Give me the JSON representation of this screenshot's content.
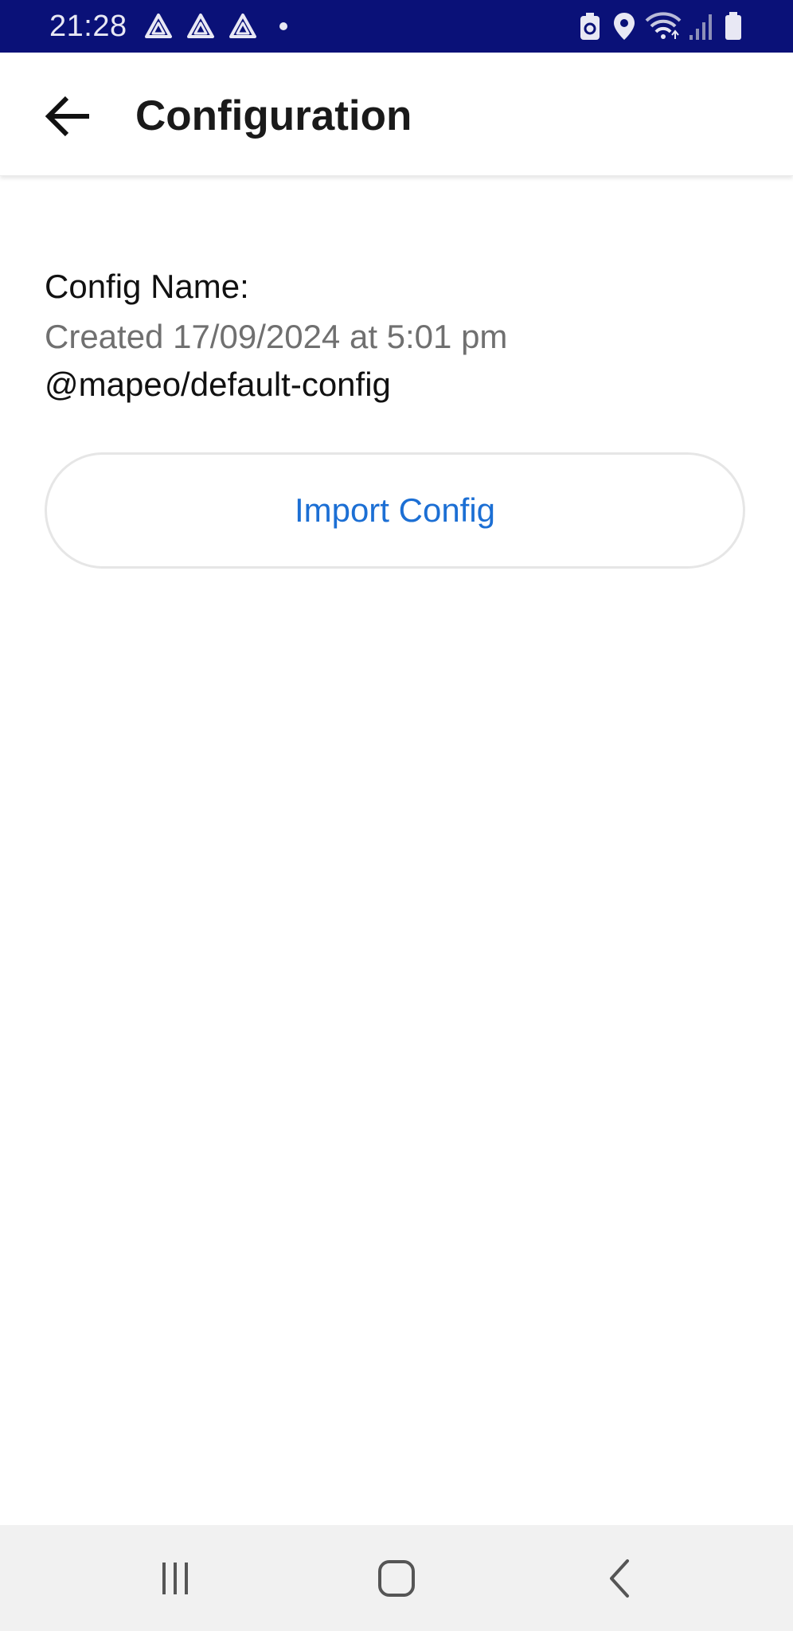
{
  "status_bar": {
    "time": "21:28",
    "background_color": "#0a1178",
    "left_icons": [
      "drive-icon",
      "drive-icon",
      "drive-icon",
      "dot-icon"
    ],
    "right_icons": [
      "battery-saver-icon",
      "location-icon",
      "wifi-icon",
      "signal-icon",
      "battery-icon"
    ]
  },
  "app_bar": {
    "back_icon": "arrow-back-icon",
    "title": "Configuration"
  },
  "config": {
    "name_label": "Config Name:",
    "created": "Created 17/09/2024 at 5:01 pm",
    "id": "@mapeo/default-config"
  },
  "import_button": {
    "label": "Import Config",
    "color": "#1c6fd4"
  },
  "nav_bar": {
    "buttons": [
      "recent-apps-icon",
      "home-icon",
      "back-icon"
    ]
  }
}
